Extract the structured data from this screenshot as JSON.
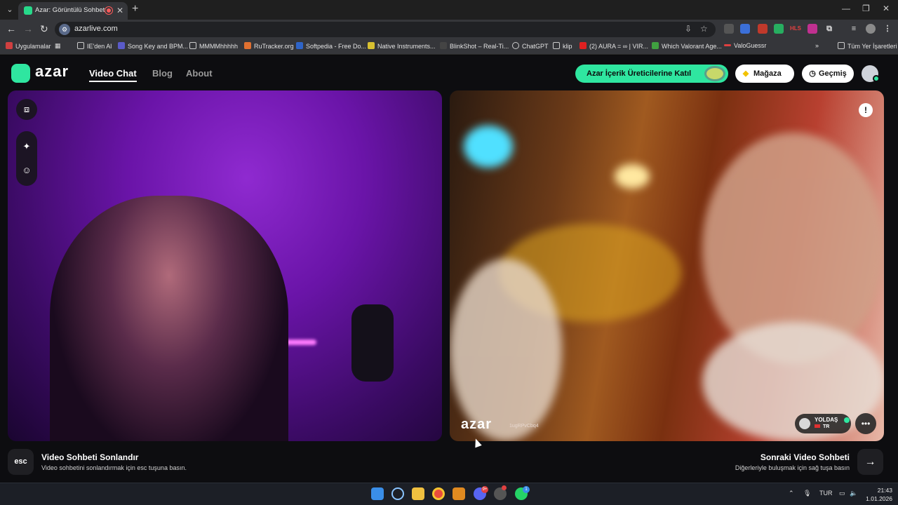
{
  "browser": {
    "tab_title": "Azar: Görüntülü Sohbet & Y",
    "url": "azarlive.com",
    "bookmarks": [
      "Uygulamalar",
      "IE'den Al",
      "Song Key and BPM...",
      "MMMMhhhhh",
      "RuTracker.org",
      "Softpedia - Free Do...",
      "Native Instruments...",
      "BlinkShot – Real-Ti...",
      "ChatGPT",
      "klip",
      "(2) AURA = ∞ | VIR...",
      "Which Valorant Age...",
      "ValoGuessr"
    ],
    "all_bookmarks": "Tüm Yer İşaretleri",
    "overflow": "»"
  },
  "header": {
    "logo": "azar",
    "nav": [
      "Video Chat",
      "Blog",
      "About"
    ],
    "creators_button": "Azar İçerik Üreticilerine Katıl",
    "shop_button": "Mağaza",
    "history_button": "Geçmiş"
  },
  "remote": {
    "watermark": "azar",
    "watermark_id": "1ugRPvCbq4",
    "partner_name": "YOLDAŞ",
    "partner_country": "TR",
    "report_icon": "!"
  },
  "footer": {
    "esc_key": "esc",
    "end_title": "Video Sohbeti Sonlandır",
    "end_sub": "Video sohbetini sonlandırmak için esc tuşuna basın.",
    "next_title": "Sonraki Video Sohbeti",
    "next_sub": "Diğerleriyle buluşmak için sağ tuşa basın",
    "next_icon": "→"
  },
  "taskbar": {
    "language": "TUR",
    "time": "21:43",
    "date": "1.01.2026",
    "discord_badge": "9+",
    "whatsapp_badge": "1"
  },
  "colors": {
    "brand": "#2fe6a0",
    "page_bg": "#0d0d10"
  }
}
